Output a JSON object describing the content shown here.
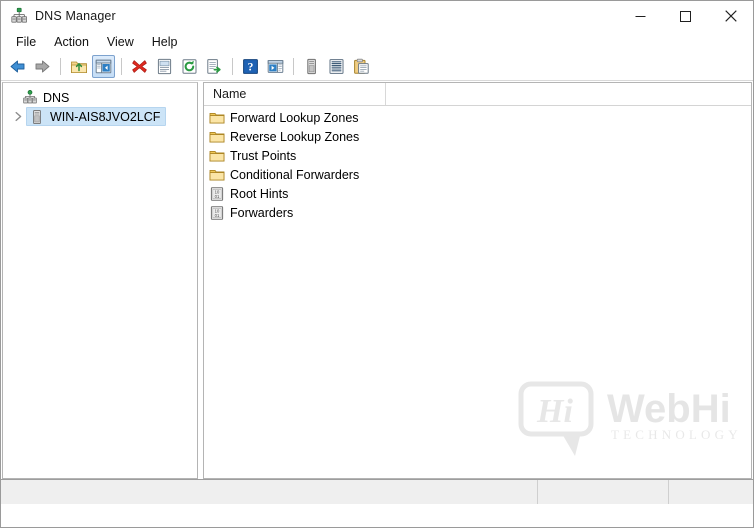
{
  "window": {
    "title": "DNS Manager",
    "icon": "dns-server-icon",
    "controls": {
      "minimize": "minimize-button",
      "maximize": "maximize-button",
      "close": "close-button"
    }
  },
  "menubar": {
    "items": [
      {
        "label": "File"
      },
      {
        "label": "Action"
      },
      {
        "label": "View"
      },
      {
        "label": "Help"
      }
    ]
  },
  "toolbar": {
    "buttons": [
      {
        "name": "back-icon",
        "tooltip": "Back"
      },
      {
        "name": "forward-icon",
        "tooltip": "Forward"
      },
      {
        "name": "separator-1"
      },
      {
        "name": "up-one-level-icon",
        "tooltip": "Up One Level"
      },
      {
        "name": "show-hide-console-tree-icon",
        "tooltip": "Show/Hide Console Tree",
        "pressed": true
      },
      {
        "name": "separator-2"
      },
      {
        "name": "delete-icon",
        "tooltip": "Delete"
      },
      {
        "name": "properties-icon",
        "tooltip": "Properties"
      },
      {
        "name": "refresh-icon",
        "tooltip": "Refresh"
      },
      {
        "name": "export-list-icon",
        "tooltip": "Export List"
      },
      {
        "name": "separator-3"
      },
      {
        "name": "help-icon",
        "tooltip": "Help"
      },
      {
        "name": "show-hide-action-pane-icon",
        "tooltip": "Show/Hide Action Pane"
      },
      {
        "name": "separator-4"
      },
      {
        "name": "new-server-icon",
        "tooltip": "Connect to DNS Server"
      },
      {
        "name": "list-view-icon",
        "tooltip": "View"
      },
      {
        "name": "paste-icon",
        "tooltip": "Paste"
      }
    ]
  },
  "tree": {
    "root": {
      "label": "DNS",
      "icon": "dns-root-icon"
    },
    "nodes": [
      {
        "label": "WIN-AIS8JVO2LCF",
        "icon": "server-icon",
        "selected": true,
        "expandable": true,
        "expanded": false
      }
    ]
  },
  "listview": {
    "columns": [
      {
        "label": "Name"
      },
      {
        "label": ""
      }
    ],
    "rows": [
      {
        "name": "Forward Lookup Zones",
        "icon": "folder-icon"
      },
      {
        "name": "Reverse Lookup Zones",
        "icon": "folder-icon"
      },
      {
        "name": "Trust Points",
        "icon": "folder-icon"
      },
      {
        "name": "Conditional Forwarders",
        "icon": "folder-icon"
      },
      {
        "name": "Root Hints",
        "icon": "data-list-icon"
      },
      {
        "name": "Forwarders",
        "icon": "data-list-icon"
      }
    ]
  },
  "statusbar": {
    "cells": [
      "",
      "",
      ""
    ]
  },
  "watermark": {
    "badge": "Hi",
    "brand": "WebHi",
    "tagline": "TECHNOLOGY"
  },
  "colors": {
    "selection": "#cce4f7",
    "selection_border": "#b6d5ef",
    "folder": "#fcd87f",
    "toolbar_pressed": "#c4ddf6",
    "border": "#b4b4b4",
    "status_bg": "#efefef"
  }
}
